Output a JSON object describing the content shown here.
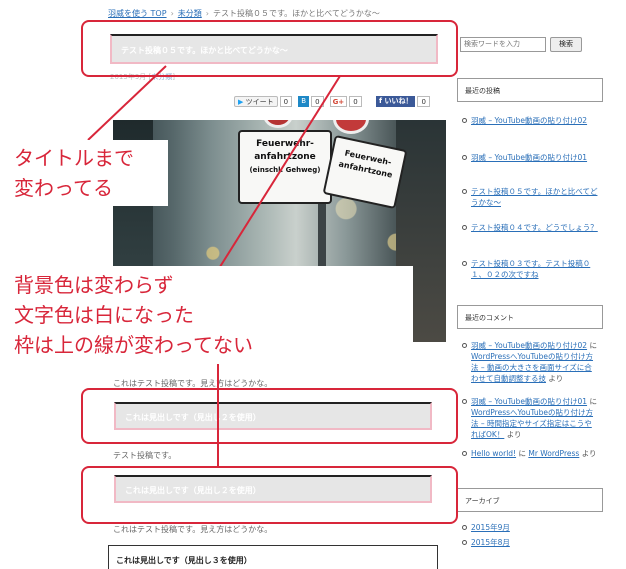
{
  "breadcrumb": {
    "home": "羽威を使う TOP",
    "category": "未分類",
    "current": "テスト投稿０５です。ほかと比べてどうかな〜"
  },
  "post": {
    "title": "テスト投稿０５です。ほかと比べてどうかな〜",
    "date": "2015年9月",
    "category_link": "未分類",
    "share": {
      "tweet": "ツイート",
      "tweet_count": "0",
      "hatena_count": "0",
      "gplus": "G+",
      "gplus_count": "0",
      "fb_like": "いいね！",
      "fb_count": "0"
    },
    "photo": {
      "sign1_line1": "Feuerwehr-",
      "sign1_line2": "anfahrtzone",
      "sign1_line3": "(einschl. Gehweg)",
      "sign2_line1": "Feuerweh-",
      "sign2_line2": "anfahrtzone"
    },
    "paragraph1": "これはテスト投稿です。見え方はどうかな。",
    "heading2_a": "これは見出しです（見出し２を使用）",
    "paragraph2": "テスト投稿です。",
    "heading2_b": "これは見出しです（見出し２を使用）",
    "paragraph3": "これはテスト投稿です。見え方はどうかな。",
    "heading3": "これは見出しです（見出し３を使用）"
  },
  "annotations": {
    "callout1": [
      "タイトルまで",
      "変わってる"
    ],
    "callout2": [
      "背景色は変わらず",
      "文字色は白になった",
      "枠は上の線が変わってない"
    ],
    "frame_color": "#d8263a"
  },
  "sidebar": {
    "search_placeholder": "検索ワードを入力",
    "search_button": "検索",
    "recent_posts_title": "最近の投稿",
    "recent_posts": [
      "羽威 – YouTube動画の貼り付け02",
      "羽威 – YouTube動画の貼り付け01",
      "テスト投稿０５です。ほかと比べてどうかな〜",
      "テスト投稿０４です。どうでしょう？",
      "テスト投稿０３です。テスト投稿０１、０２の次ですね"
    ],
    "recent_comments_title": "最近のコメント",
    "recent_comments": [
      {
        "link": "羽威 – YouTube動画の貼り付け02",
        "on": " に ",
        "post": "WordPressへYouTubeの貼り付け方法 – 動画の大きさを画面サイズに合わせて自動調整する技",
        "by": " より"
      },
      {
        "link": "羽威 – YouTube動画の貼り付け01",
        "on": " に ",
        "post": "WordPressへYouTubeの貼り付け方法 – 時間指定やサイズ指定はこうやればOK！",
        "by": " より"
      },
      {
        "link": "Hello world!",
        "on": " に ",
        "post": "Mr WordPress",
        "by": " より"
      }
    ],
    "archives_title": "アーカイブ",
    "archives": [
      "2015年9月",
      "2015年8月"
    ]
  }
}
